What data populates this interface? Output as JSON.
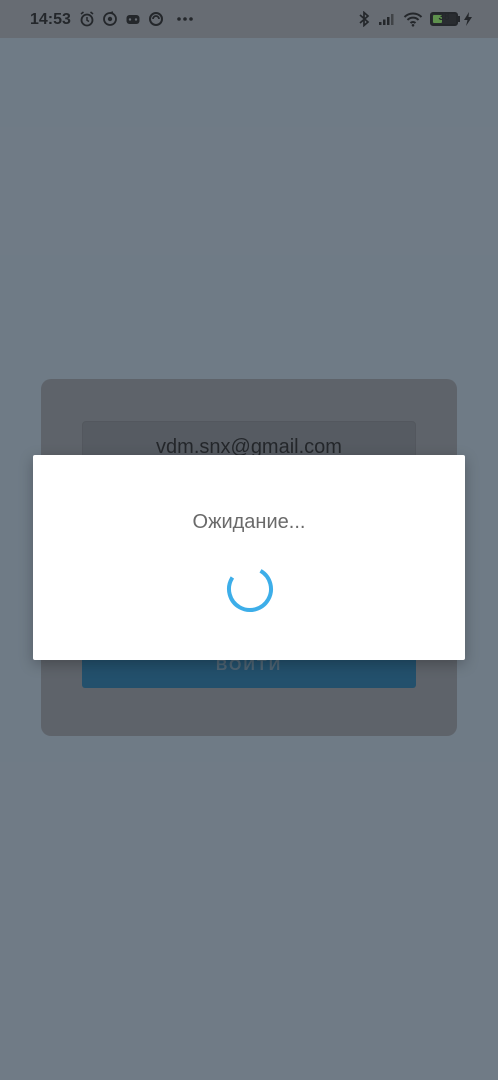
{
  "status_bar": {
    "time": "14:53",
    "battery_level": "38",
    "left_icons": [
      "alarm-icon",
      "navigation-icon",
      "gamepad-icon",
      "vpn-icon",
      "more-dots-icon"
    ],
    "right_icons": [
      "bluetooth-icon",
      "signal-icon",
      "wifi-icon",
      "battery-icon",
      "charging-icon"
    ]
  },
  "login_form": {
    "email_value": "vdm.snx@gmail.com",
    "login_button_label": "ВОЙТИ"
  },
  "dialog": {
    "message": "Ожидание...",
    "spinner_color": "#3daee9"
  }
}
